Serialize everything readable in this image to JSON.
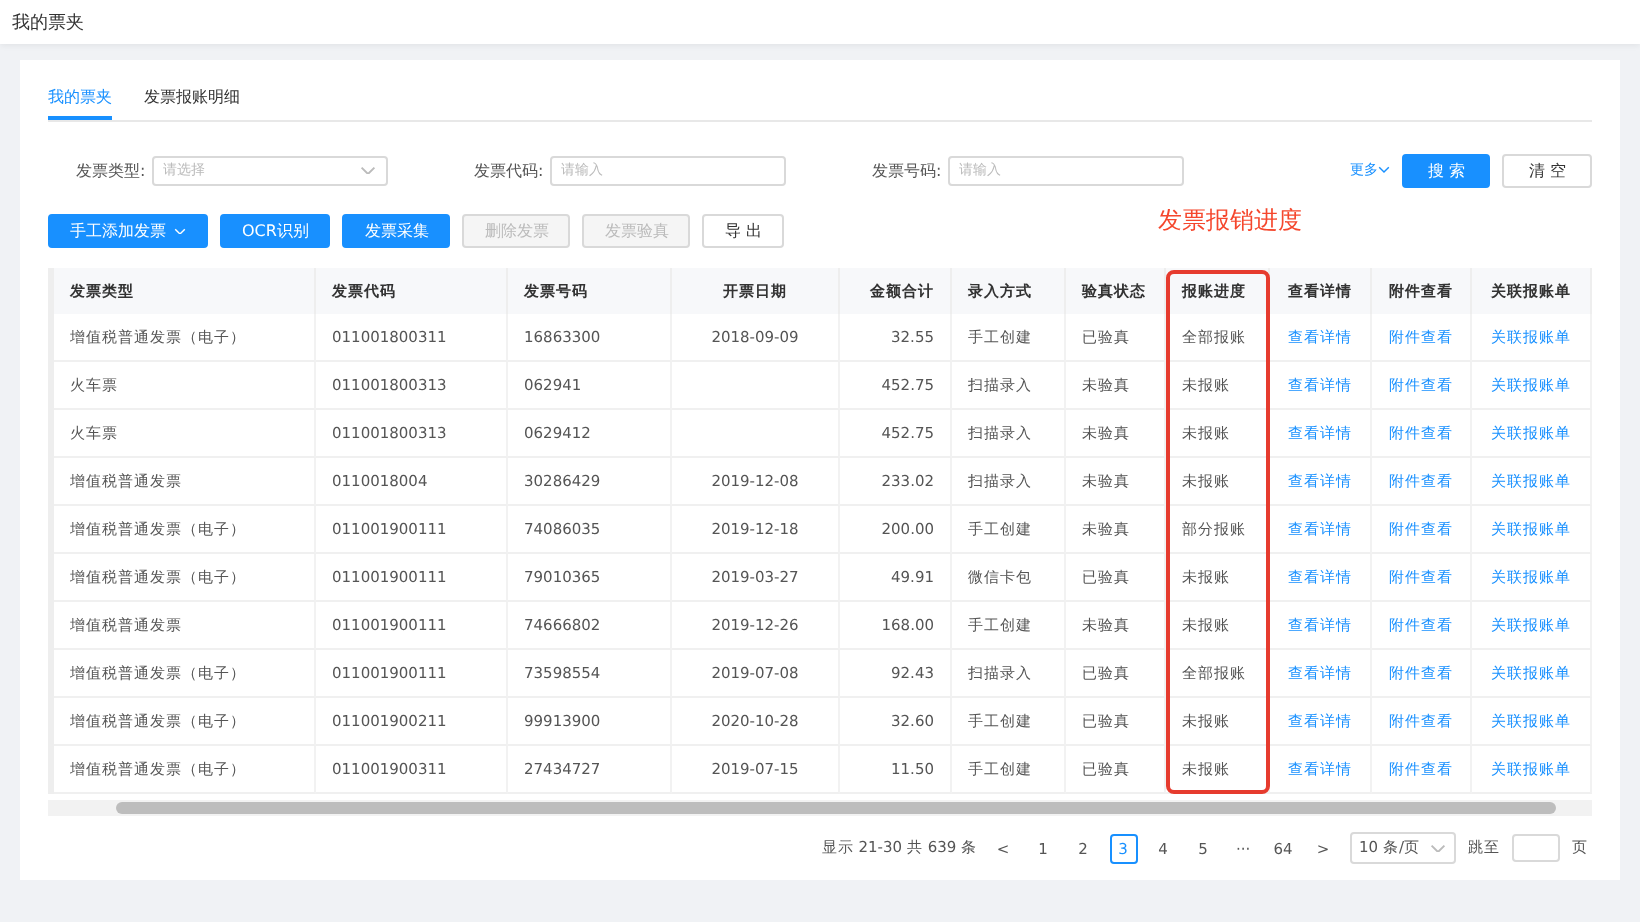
{
  "header": {
    "title": "我的票夹"
  },
  "tabs": [
    {
      "label": "我的票夹",
      "selected": true
    },
    {
      "label": "发票报账明细",
      "selected": false
    }
  ],
  "filters": [
    {
      "label": "发票类型:",
      "placeholder": "请选择",
      "kind": "select"
    },
    {
      "label": "发票代码:",
      "placeholder": "请输入",
      "kind": "input"
    },
    {
      "label": "发票号码:",
      "placeholder": "请输入",
      "kind": "input"
    }
  ],
  "more_link": "更多",
  "search_buttons": [
    {
      "label": "搜 索",
      "kind": "primary"
    },
    {
      "label": "清 空",
      "kind": "default"
    }
  ],
  "actions": [
    {
      "label": "手工添加发票",
      "kind": "primary",
      "dropdown": true,
      "disabled": false
    },
    {
      "label": "OCR识别",
      "kind": "primary",
      "dropdown": false,
      "disabled": false
    },
    {
      "label": "发票采集",
      "kind": "primary",
      "dropdown": false,
      "disabled": false
    },
    {
      "label": "删除发票",
      "kind": "default",
      "dropdown": false,
      "disabled": true
    },
    {
      "label": "发票验真",
      "kind": "default",
      "dropdown": false,
      "disabled": true
    },
    {
      "label": "导 出",
      "kind": "default",
      "dropdown": false,
      "disabled": false
    }
  ],
  "annotation": "发票报销进度",
  "table": {
    "columns": [
      {
        "label": "发票类型",
        "kind": "text",
        "highlighted": false
      },
      {
        "label": "发票代码",
        "kind": "text",
        "highlighted": false
      },
      {
        "label": "发票号码",
        "kind": "text",
        "highlighted": false
      },
      {
        "label": "开票日期",
        "kind": "text",
        "highlighted": false
      },
      {
        "label": "金额合计",
        "kind": "text",
        "highlighted": false
      },
      {
        "label": "录入方式",
        "kind": "text",
        "highlighted": false
      },
      {
        "label": "验真状态",
        "kind": "text",
        "highlighted": false
      },
      {
        "label": "报账进度",
        "kind": "text",
        "highlighted": true
      },
      {
        "label": "查看详情",
        "kind": "link",
        "highlighted": false
      },
      {
        "label": "附件查看",
        "kind": "link",
        "highlighted": false
      },
      {
        "label": "关联报账单",
        "kind": "link",
        "highlighted": false
      }
    ],
    "rows": [
      [
        "增值税普通发票（电子）",
        "011001800311",
        "16863300",
        "2018-09-09",
        "32.55",
        "手工创建",
        "已验真",
        "全部报账",
        "查看详情",
        "附件查看",
        "关联报账单"
      ],
      [
        "火车票",
        "011001800313",
        "062941",
        "",
        "452.75",
        "扫描录入",
        "未验真",
        "未报账",
        "查看详情",
        "附件查看",
        "关联报账单"
      ],
      [
        "火车票",
        "011001800313",
        "0629412",
        "",
        "452.75",
        "扫描录入",
        "未验真",
        "未报账",
        "查看详情",
        "附件查看",
        "关联报账单"
      ],
      [
        "增值税普通发票",
        "0110018004",
        "30286429",
        "2019-12-08",
        "233.02",
        "扫描录入",
        "未验真",
        "未报账",
        "查看详情",
        "附件查看",
        "关联报账单"
      ],
      [
        "增值税普通发票（电子）",
        "011001900111",
        "74086035",
        "2019-12-18",
        "200.00",
        "手工创建",
        "未验真",
        "部分报账",
        "查看详情",
        "附件查看",
        "关联报账单"
      ],
      [
        "增值税普通发票（电子）",
        "011001900111",
        "79010365",
        "2019-03-27",
        "49.91",
        "微信卡包",
        "已验真",
        "未报账",
        "查看详情",
        "附件查看",
        "关联报账单"
      ],
      [
        "增值税普通发票",
        "011001900111",
        "74666802",
        "2019-12-26",
        "168.00",
        "手工创建",
        "未验真",
        "未报账",
        "查看详情",
        "附件查看",
        "关联报账单"
      ],
      [
        "增值税普通发票（电子）",
        "011001900111",
        "73598554",
        "2019-07-08",
        "92.43",
        "扫描录入",
        "已验真",
        "全部报账",
        "查看详情",
        "附件查看",
        "关联报账单"
      ],
      [
        "增值税普通发票（电子）",
        "011001900211",
        "99913900",
        "2020-10-28",
        "32.60",
        "手工创建",
        "已验真",
        "未报账",
        "查看详情",
        "附件查看",
        "关联报账单"
      ],
      [
        "增值税普通发票（电子）",
        "011001900311",
        "27434727",
        "2019-07-15",
        "11.50",
        "手工创建",
        "已验真",
        "未报账",
        "查看详情",
        "附件查看",
        "关联报账单"
      ]
    ]
  },
  "pagination": {
    "summary": "显示 21-30 共 639 条",
    "prev": "<",
    "next": ">",
    "pages": [
      {
        "label": "1",
        "selected": false
      },
      {
        "label": "2",
        "selected": false
      },
      {
        "label": "3",
        "selected": true
      },
      {
        "label": "4",
        "selected": false
      },
      {
        "label": "5",
        "selected": false
      },
      {
        "label": "···",
        "selected": false
      },
      {
        "label": "64",
        "selected": false
      }
    ],
    "page_size": "10 条/页",
    "jump_label": "跳至",
    "jump_suffix": "页"
  }
}
